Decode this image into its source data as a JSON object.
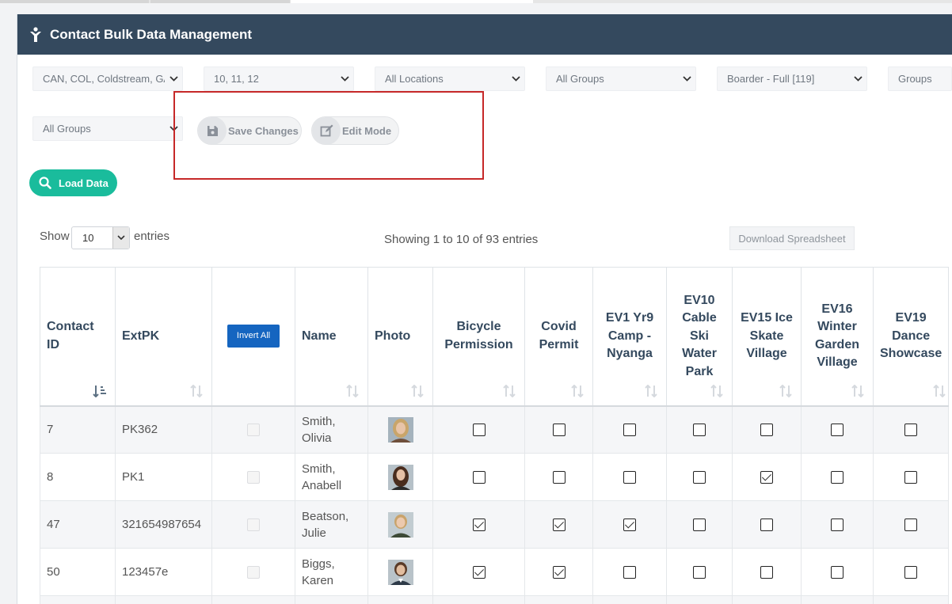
{
  "panel": {
    "title": "Contact Bulk Data Management"
  },
  "filters": {
    "campus": "CAN, COL, Coldstream, GA",
    "years": "10, 11, 12",
    "locations": "All Locations",
    "groups1": "All Groups",
    "boarder": "Boarder - Full [119]",
    "groups_label": "Groups",
    "groups2": "All Groups"
  },
  "actions": {
    "save": "Save Changes",
    "edit": "Edit Mode",
    "load": "Load Data",
    "download": "Download Spreadsheet"
  },
  "table_controls": {
    "show": "Show",
    "entries_value": "10",
    "entries": "entries",
    "info": "Showing 1 to 10 of 93 entries"
  },
  "table": {
    "headers": {
      "contact_id": "Contact ID",
      "extpk": "ExtPK",
      "invert_all": "Invert All",
      "name": "Name",
      "photo": "Photo",
      "bicycle": "Bicycle Permission",
      "covid": "Covid Permit",
      "ev1": "EV1 Yr9 Camp - Nyanga",
      "ev10": "EV10 Cable Ski Water Park",
      "ev15": "EV15 Ice Skate Village",
      "ev16": "EV16 Winter Garden Village",
      "ev19": "EV19 Dance Showcase"
    },
    "rows": [
      {
        "id": "7",
        "extpk": "PK362",
        "name": "Smith, Olivia",
        "bicycle": false,
        "covid": false,
        "ev1": false,
        "ev10": false,
        "ev15": false,
        "ev16": false,
        "ev19": false
      },
      {
        "id": "8",
        "extpk": "PK1",
        "name": "Smith, Anabell",
        "bicycle": false,
        "covid": false,
        "ev1": false,
        "ev10": false,
        "ev15": true,
        "ev16": false,
        "ev19": false
      },
      {
        "id": "47",
        "extpk": "321654987654",
        "name": "Beatson, Julie",
        "bicycle": true,
        "covid": true,
        "ev1": true,
        "ev10": false,
        "ev15": false,
        "ev16": false,
        "ev19": false
      },
      {
        "id": "50",
        "extpk": "123457e",
        "name": "Biggs, Karen",
        "bicycle": true,
        "covid": true,
        "ev1": false,
        "ev10": false,
        "ev15": false,
        "ev16": false,
        "ev19": false
      }
    ]
  },
  "colors": {
    "header_bg": "#34495e",
    "accent_green": "#1abc9c",
    "button_blue": "#1565c0",
    "highlight": "#c62828"
  }
}
